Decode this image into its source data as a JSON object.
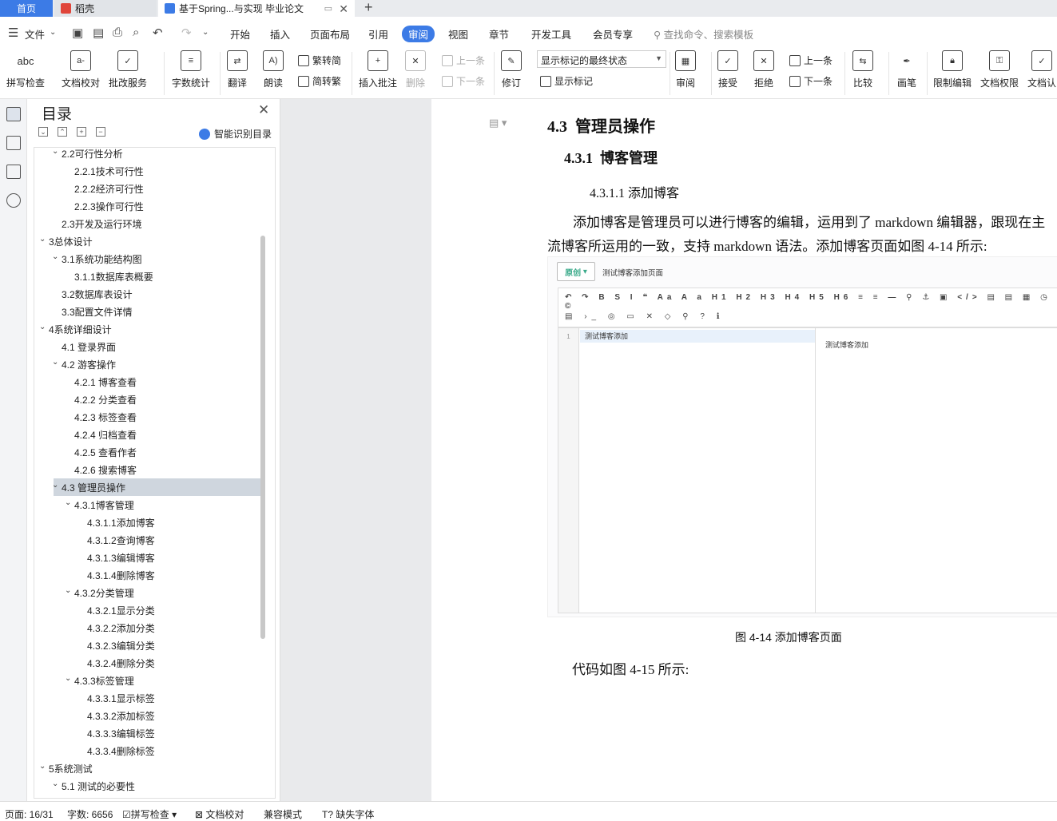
{
  "tabs": {
    "home": "首页",
    "wps": "稻壳",
    "doc": "基于Spring...与实现 毕业论文"
  },
  "menu": {
    "file": "文件",
    "start": "开始",
    "insert": "插入",
    "layout": "页面布局",
    "ref": "引用",
    "review": "审阅",
    "view": "视图",
    "chapter": "章节",
    "dev": "开发工具",
    "member": "会员专享",
    "search": "查找命令、搜索模板"
  },
  "ribbon": {
    "spell": "拼写检查",
    "proof": "文档校对",
    "service": "批改服务",
    "wordcount": "字数统计",
    "translate": "翻译",
    "read": "朗读",
    "trad": "繁转简",
    "simp": "简转繁",
    "insert_comment": "插入批注",
    "delete": "删除",
    "prev": "上一条",
    "next": "下一条",
    "revise": "修订",
    "final_state": "显示标记的最终状态",
    "show_marks": "显示标记",
    "review": "审阅",
    "accept": "接受",
    "reject": "拒绝",
    "prev2": "上一条",
    "next2": "下一条",
    "compare": "比较",
    "pen": "画笔",
    "restrict": "限制编辑",
    "perm": "文档权限",
    "cert": "文档认"
  },
  "toc": {
    "title": "目录",
    "smart": "智能识别目录",
    "items": [
      {
        "label": "2.2可行性分析",
        "level": 1,
        "expand": true
      },
      {
        "label": "2.2.1技术可行性",
        "level": 2
      },
      {
        "label": "2.2.2经济可行性",
        "level": 2
      },
      {
        "label": "2.2.3操作可行性",
        "level": 2
      },
      {
        "label": "2.3开发及运行环境",
        "level": 1
      },
      {
        "label": "3总体设计",
        "level": 0,
        "expand": true
      },
      {
        "label": "3.1系统功能结构图",
        "level": 1,
        "expand": true
      },
      {
        "label": "3.1.1数据库表概要",
        "level": 2
      },
      {
        "label": "3.2数据库表设计",
        "level": 1
      },
      {
        "label": "3.3配置文件详情",
        "level": 1
      },
      {
        "label": "4系统详细设计",
        "level": 0,
        "expand": true
      },
      {
        "label": "4.1  登录界面",
        "level": 1
      },
      {
        "label": "4.2  游客操作",
        "level": 1,
        "expand": true
      },
      {
        "label": "4.2.1  博客查看",
        "level": 2
      },
      {
        "label": "4.2.2  分类查看",
        "level": 2
      },
      {
        "label": "4.2.3  标签查看",
        "level": 2
      },
      {
        "label": "4.2.4  归档查看",
        "level": 2
      },
      {
        "label": "4.2.5  查看作者",
        "level": 2
      },
      {
        "label": "4.2.6  搜索博客",
        "level": 2
      },
      {
        "label": "4.3  管理员操作",
        "level": 1,
        "expand": true,
        "selected": true
      },
      {
        "label": "4.3.1博客管理",
        "level": 2,
        "expand": true
      },
      {
        "label": "4.3.1.1添加博客",
        "level": 3
      },
      {
        "label": "4.3.1.2查询博客",
        "level": 3
      },
      {
        "label": "4.3.1.3编辑博客",
        "level": 3
      },
      {
        "label": "4.3.1.4删除博客",
        "level": 3
      },
      {
        "label": "4.3.2分类管理",
        "level": 2,
        "expand": true
      },
      {
        "label": "4.3.2.1显示分类",
        "level": 3
      },
      {
        "label": "4.3.2.2添加分类",
        "level": 3
      },
      {
        "label": "4.3.2.3编辑分类",
        "level": 3
      },
      {
        "label": "4.3.2.4删除分类",
        "level": 3
      },
      {
        "label": "4.3.3标签管理",
        "level": 2,
        "expand": true
      },
      {
        "label": "4.3.3.1显示标签",
        "level": 3
      },
      {
        "label": "4.3.3.2添加标签",
        "level": 3
      },
      {
        "label": "4.3.3.3编辑标签",
        "level": 3
      },
      {
        "label": "4.3.3.4删除标签",
        "level": 3
      },
      {
        "label": "5系统测试",
        "level": 0,
        "expand": true
      },
      {
        "label": "5.1 测试的必要性",
        "level": 1,
        "expand": true
      }
    ]
  },
  "doc": {
    "h2_num": "4.3",
    "h2": "管理员操作",
    "h3_num": "4.3.1",
    "h3": "博客管理",
    "h4": "4.3.1.1 添加博客",
    "para": "添加博客是管理员可以进行博客的编辑，运用到了 markdown 编辑器，跟现在主流博客所运用的一致，支持 markdown 语法。添加博客页面如图 4-14 所示:",
    "caption": "图 4-14 添加博客页面",
    "para2": "代码如图 4-15 所示:",
    "shot": {
      "orig": "原创",
      "title": "测试博客添加页面",
      "toolbar1": "↶ ↷ B S I ❝ Aa A a H1 H2 H3 H4 H5 H6 ≡ ≡ — ⚲ ⚓ ▣ </> ▤ ▤ ▦ ◷ ☺ ©",
      "toolbar2": "▤ ›_ ◎ ▭ ✕ ◇ ⚲ ? ℹ",
      "line_no": "1",
      "line1": "测试博客添加",
      "preview": "测试博客添加"
    }
  },
  "status": {
    "page": "页面: 16/31",
    "words": "字数: 6656",
    "spell": "拼写检查",
    "proof": "文档校对",
    "compat": "兼容模式",
    "font": "缺失字体"
  }
}
